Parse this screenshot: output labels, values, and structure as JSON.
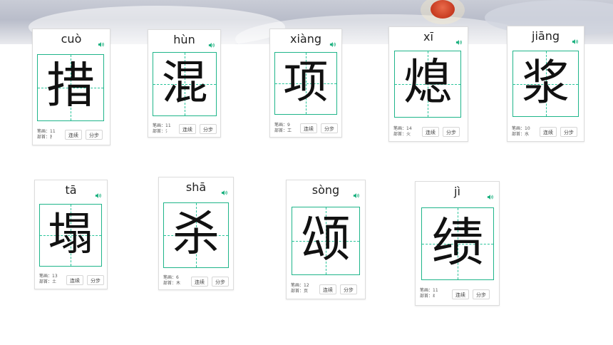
{
  "labels": {
    "strokes_prefix": "笔画：",
    "radical_prefix": "部首：",
    "continuous": "连续",
    "stepwise": "分步"
  },
  "colors": {
    "grid": "#1fb58a",
    "sound_icon": "#19b07e"
  },
  "cards": [
    {
      "pinyin": "cuò",
      "char": "措",
      "strokes": "11",
      "radical": "扌"
    },
    {
      "pinyin": "hùn",
      "char": "混",
      "strokes": "11",
      "radical": "氵"
    },
    {
      "pinyin": "xiàng",
      "char": "项",
      "strokes": "9",
      "radical": "工"
    },
    {
      "pinyin": "xī",
      "char": "熄",
      "strokes": "14",
      "radical": "火"
    },
    {
      "pinyin": "jiāng",
      "char": "浆",
      "strokes": "10",
      "radical": "水"
    },
    {
      "pinyin": "tā",
      "char": "塌",
      "strokes": "13",
      "radical": "土"
    },
    {
      "pinyin": "shā",
      "char": "杀",
      "strokes": "6",
      "radical": "木"
    },
    {
      "pinyin": "sòng",
      "char": "颂",
      "strokes": "12",
      "radical": "页"
    },
    {
      "pinyin": "jì",
      "char": "绩",
      "strokes": "11",
      "radical": "纟"
    }
  ]
}
